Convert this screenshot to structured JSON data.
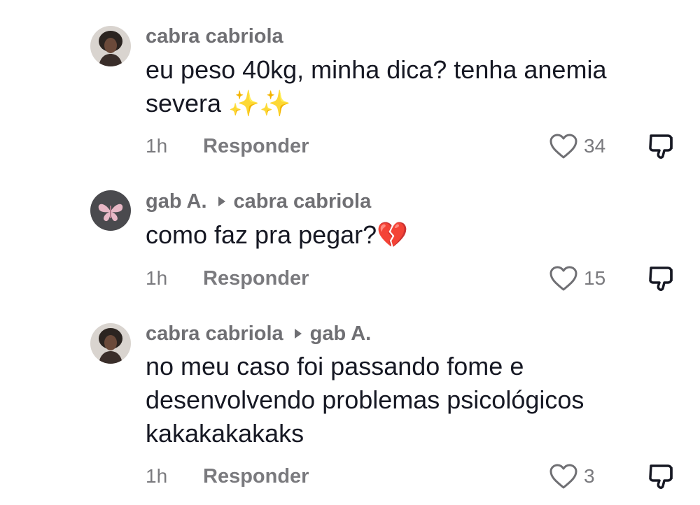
{
  "comments": [
    {
      "author": "cabra cabriola",
      "reply_to": "",
      "text_lines": [
        "eu peso 40kg, minha dica? tenha anemia",
        "severa "
      ],
      "emoji": "✨✨",
      "time": "1h",
      "reply_label": "Responder",
      "likes": "34"
    },
    {
      "author": "gab A.",
      "reply_to": "cabra cabriola",
      "text_lines": [
        "como faz pra pegar?"
      ],
      "emoji": "💔",
      "time": "1h",
      "reply_label": "Responder",
      "likes": "15"
    },
    {
      "author": "cabra cabriola",
      "reply_to": "gab A.",
      "text_lines": [
        "no meu caso foi passando fome e",
        "desenvolvendo problemas psicológicos",
        "kakakakakaks"
      ],
      "emoji": "",
      "time": "1h",
      "reply_label": "Responder",
      "likes": "3"
    }
  ],
  "icons": {
    "like": "heart-outline-icon",
    "dislike": "thumbs-down-icon",
    "reply_indicator": "triangle-right-icon"
  },
  "colors": {
    "text_primary": "#161823",
    "text_secondary": "#6f6f73",
    "sparkle": "#f5c518",
    "broken_heart": "#e8334a"
  }
}
